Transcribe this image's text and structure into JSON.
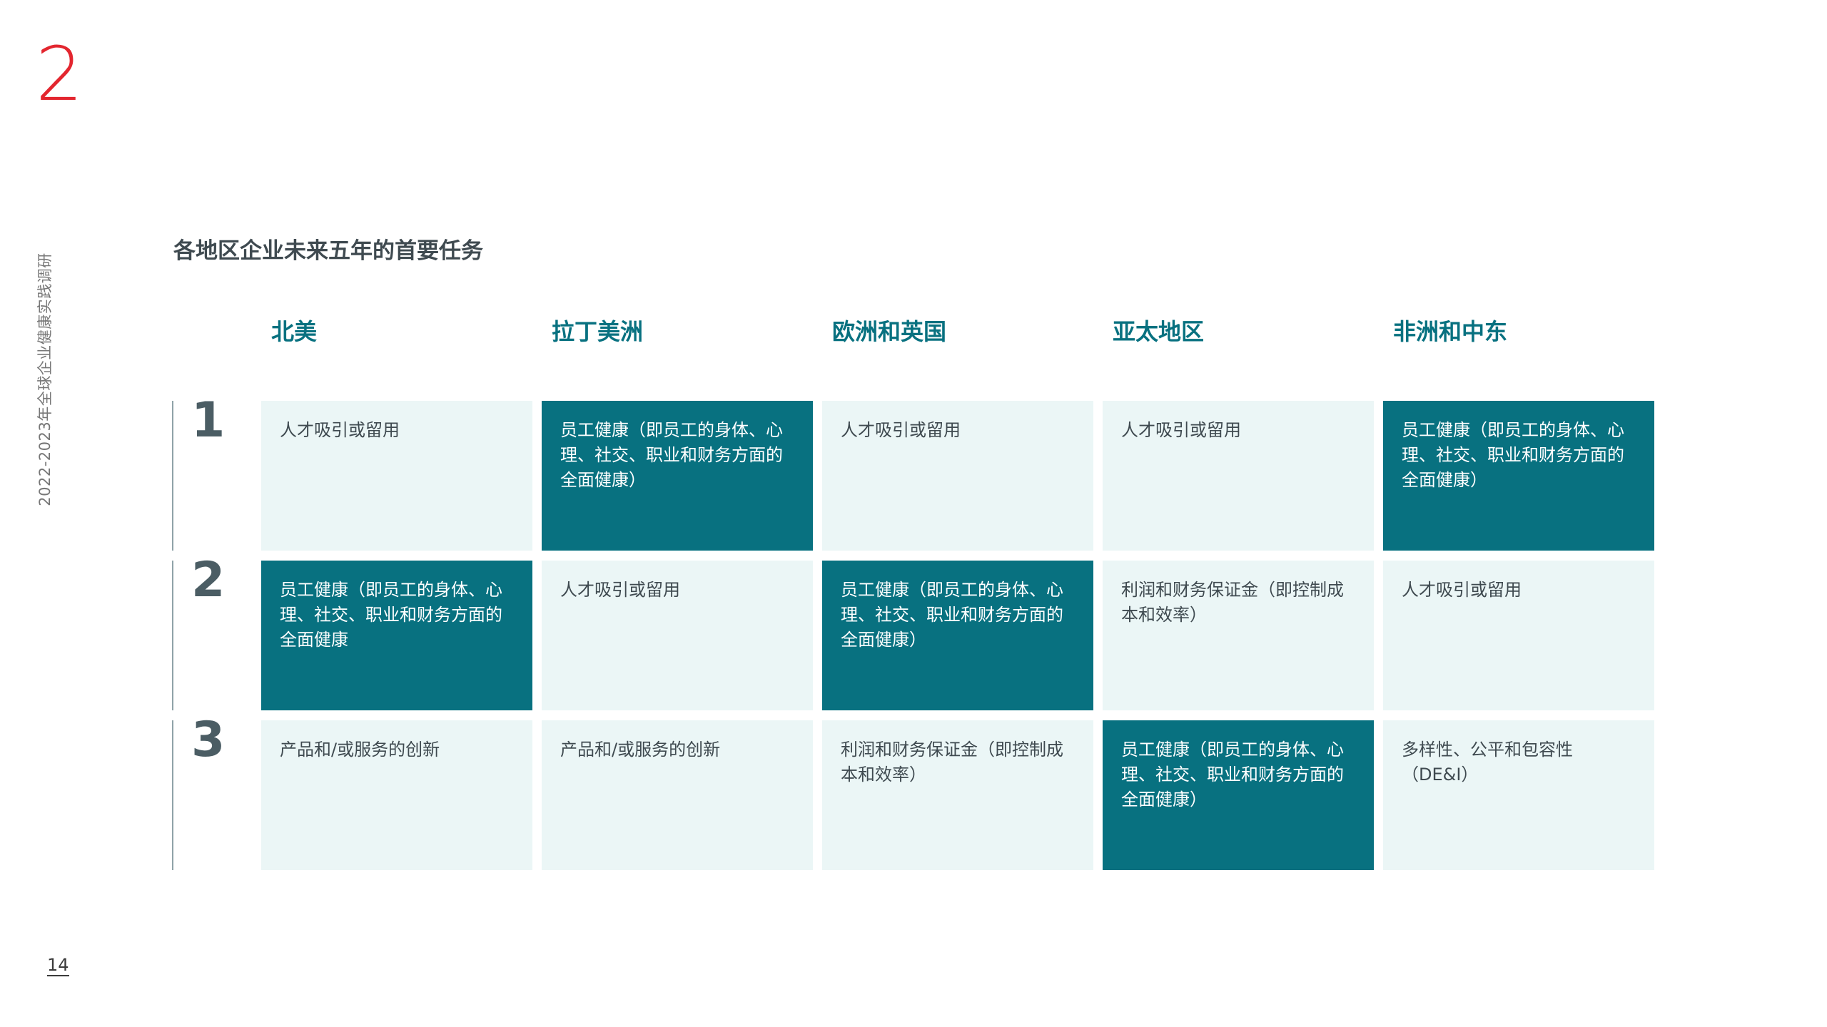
{
  "section_number": "2",
  "side_label": "2022-2023年全球企业健康实践调研",
  "page_number": "14",
  "title": "各地区企业未来五年的首要任务",
  "regions": [
    "北美",
    "拉丁美洲",
    "欧洲和英国",
    "亚太地区",
    "非洲和中东"
  ],
  "ranks": [
    "1",
    "2",
    "3"
  ],
  "rows": [
    {
      "cells": [
        {
          "text": "人才吸引或留用",
          "highlight": false
        },
        {
          "text": "员工健康（即员工的身体、心理、社交、职业和财务方面的全面健康）",
          "highlight": true
        },
        {
          "text": "人才吸引或留用",
          "highlight": false
        },
        {
          "text": "人才吸引或留用",
          "highlight": false
        },
        {
          "text": "员工健康（即员工的身体、心理、社交、职业和财务方面的全面健康）",
          "highlight": true
        }
      ]
    },
    {
      "cells": [
        {
          "text": "员工健康（即员工的身体、心理、社交、职业和财务方面的全面健康",
          "highlight": true
        },
        {
          "text": "人才吸引或留用",
          "highlight": false
        },
        {
          "text": "员工健康（即员工的身体、心理、社交、职业和财务方面的全面健康）",
          "highlight": true
        },
        {
          "text": "利润和财务保证金（即控制成本和效率）",
          "highlight": false
        },
        {
          "text": "人才吸引或留用",
          "highlight": false
        }
      ]
    },
    {
      "cells": [
        {
          "text": "产品和/或服务的创新",
          "highlight": false
        },
        {
          "text": "产品和/或服务的创新",
          "highlight": false
        },
        {
          "text": "利润和财务保证金（即控制成本和效率）",
          "highlight": false
        },
        {
          "text": "员工健康（即员工的身体、心理、社交、职业和财务方面的全面健康）",
          "highlight": true
        },
        {
          "text": "多样性、公平和包容性（DE&I）",
          "highlight": false
        }
      ]
    }
  ]
}
